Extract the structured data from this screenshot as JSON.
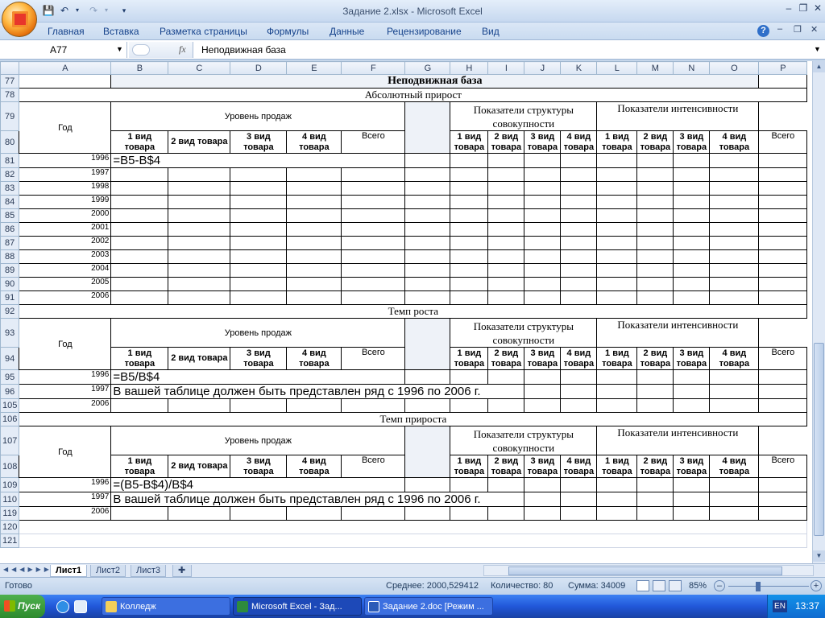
{
  "window": {
    "title": "Задание 2.xlsx - Microsoft Excel",
    "help": "?",
    "minimize": "–",
    "restore": "❐",
    "close": "✕"
  },
  "qat": {
    "save": "💾",
    "undo": "↶",
    "redo": "↷"
  },
  "ribbon": {
    "tabs": [
      "Главная",
      "Вставка",
      "Разметка страницы",
      "Формулы",
      "Данные",
      "Рецензирование",
      "Вид"
    ]
  },
  "formula_bar": {
    "name_box": "A77",
    "fx": "fx",
    "value": "Неподвижная база"
  },
  "columns": [
    "A",
    "B",
    "C",
    "D",
    "E",
    "F",
    "G",
    "H",
    "I",
    "J",
    "K",
    "L",
    "M",
    "N",
    "O",
    "P"
  ],
  "table": {
    "title": "Неподвижная база",
    "section1": "Абсолютный прирост",
    "section2": "Темп роста",
    "section3": "Темп прироста",
    "year_header": "Год",
    "sales_level": "Уровень продаж",
    "structure": "Показатели структуры совокупности",
    "intensity": "Показатели интенсивности",
    "p1": "1 вид товара",
    "p2": "2 вид товара",
    "p3": "3 вид товара",
    "p4": "4 вид товара",
    "total": "Всего",
    "years": [
      "1996",
      "1997",
      "1998",
      "1999",
      "2000",
      "2001",
      "2002",
      "2003",
      "2004",
      "2005",
      "2006"
    ],
    "formula1": "=B5-B$4",
    "formula2": "=B5/B$4",
    "formula3": "=(B5-B$4)/B$4",
    "note": "В вашей таблице должен быть представлен ряд с 1996 по 2006 г."
  },
  "sheets": [
    "Лист1",
    "Лист2",
    "Лист3"
  ],
  "status": {
    "ready": "Готово",
    "avg": "Среднее: 2000,529412",
    "count": "Количество: 80",
    "sum": "Сумма: 34009",
    "zoom": "85%"
  },
  "taskbar": {
    "start": "Пуск",
    "items": [
      "Колледж",
      "Microsoft Excel - Зад...",
      "Задание 2.doc [Режим ..."
    ],
    "lang": "EN",
    "clock": "13:37"
  }
}
